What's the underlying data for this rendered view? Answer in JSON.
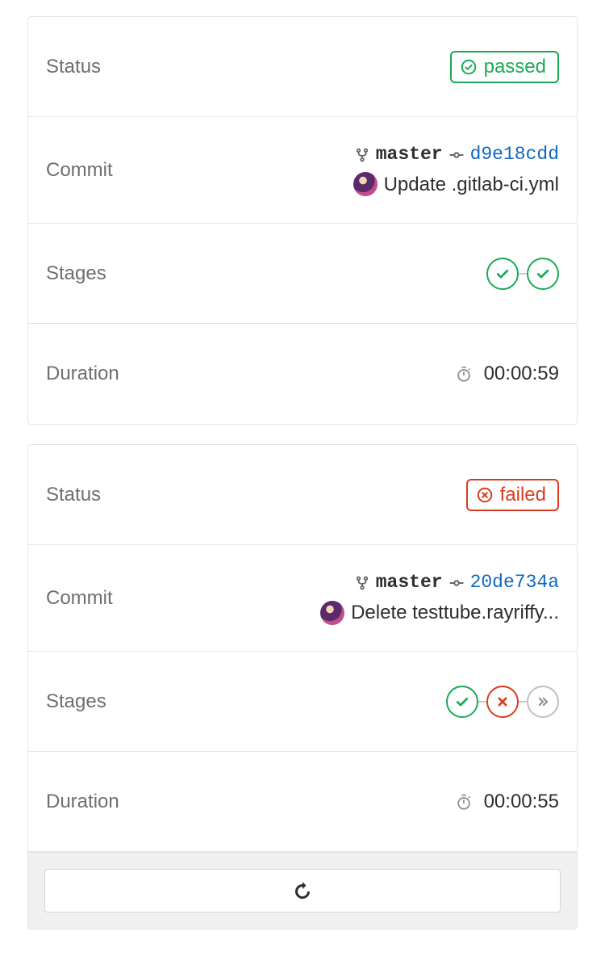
{
  "labels": {
    "status": "Status",
    "commit": "Commit",
    "stages": "Stages",
    "duration": "Duration"
  },
  "pipelines": [
    {
      "status": {
        "state": "passed",
        "label": "passed"
      },
      "commit": {
        "branch": "master",
        "sha": "d9e18cdd",
        "message": "Update .gitlab-ci.yml"
      },
      "stages": [
        "success",
        "success"
      ],
      "duration": "00:00:59",
      "has_retry": false
    },
    {
      "status": {
        "state": "failed",
        "label": "failed"
      },
      "commit": {
        "branch": "master",
        "sha": "20de734a",
        "message": "Delete testtube.rayriffy..."
      },
      "stages": [
        "success",
        "failed",
        "skipped"
      ],
      "duration": "00:00:55",
      "has_retry": true
    }
  ]
}
